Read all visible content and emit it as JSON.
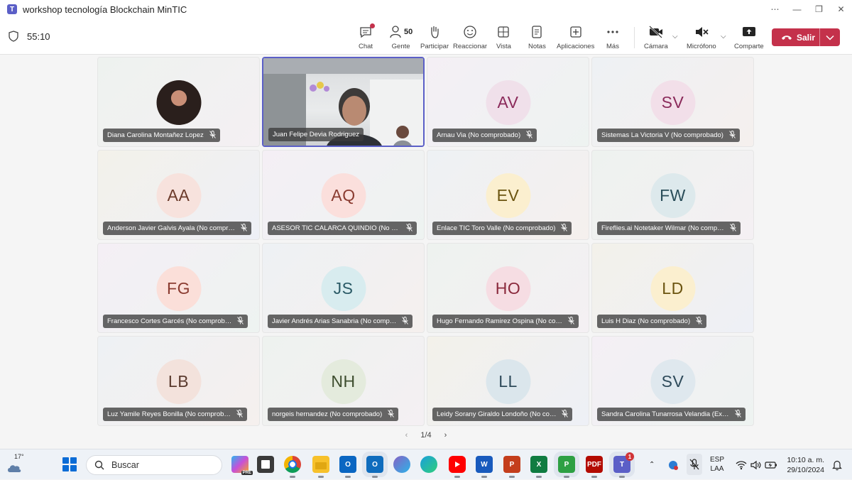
{
  "window": {
    "title": "workshop tecnología Blockchain MinTIC",
    "controls": [
      "⋯",
      "—",
      "❐",
      "✕"
    ]
  },
  "meeting": {
    "timer": "55:10",
    "tools": {
      "chat": "Chat",
      "people": "Gente",
      "people_count": "50",
      "raise": "Participar",
      "react": "Reaccionar",
      "view": "Vista",
      "notes": "Notas",
      "apps": "Aplicaciones",
      "more": "Más",
      "camera": "Cámara",
      "mic": "Micrófono",
      "share": "Comparte"
    },
    "leave": "Salir"
  },
  "participants": [
    {
      "name": "Diana Carolina Montañez Lopez",
      "initials": "",
      "photo": true
    },
    {
      "name": "Juan Felipe Devia Rodriguez",
      "initials": "",
      "video": true
    },
    {
      "name": "Arnau Via (No comprobado)",
      "initials": "AV",
      "bg": "#f0e0ea",
      "fg": "#8a2a5a"
    },
    {
      "name": "Sistemas La Victoria V (No comprobado)",
      "initials": "SV",
      "bg": "#f2dfe9",
      "fg": "#8a2a5a"
    },
    {
      "name": "Anderson Javier Galvis Ayala (No compr…",
      "initials": "AA",
      "bg": "#f7e2dd",
      "fg": "#6b3a2a"
    },
    {
      "name": "ASESOR TIC CALARCA QUINDIO (No c…",
      "initials": "AQ",
      "bg": "#fbdfdc",
      "fg": "#8a3b30"
    },
    {
      "name": "Enlace TIC Toro Valle (No comprobado)",
      "initials": "EV",
      "bg": "#fbefcf",
      "fg": "#6b5410"
    },
    {
      "name": "Fireflies.ai Notetaker Wilmar (No comp…",
      "initials": "FW",
      "bg": "#dde9ec",
      "fg": "#2a4d59"
    },
    {
      "name": "Francesco Cortes Garcés (No comprob…",
      "initials": "FG",
      "bg": "#fbdfd9",
      "fg": "#8a3b30"
    },
    {
      "name": "Javier Andrés Arias Sanabria (No comp…",
      "initials": "JS",
      "bg": "#d8ecef",
      "fg": "#2a5a66"
    },
    {
      "name": "Hugo Fernando Ramirez Ospina (No co…",
      "initials": "HO",
      "bg": "#f6dde3",
      "fg": "#8a2a3d"
    },
    {
      "name": "Luis H Diaz (No comprobado)",
      "initials": "LD",
      "bg": "#fbefcf",
      "fg": "#6b5410"
    },
    {
      "name": "Luz Yamile Reyes Bonilla (No comprob…",
      "initials": "LB",
      "bg": "#f3e2dc",
      "fg": "#5a3a2e"
    },
    {
      "name": "norgeis hernandez (No comprobado)",
      "initials": "NH",
      "bg": "#e4ebdd",
      "fg": "#3d4d2e"
    },
    {
      "name": "Leidy Sorany Giraldo Londoño (No co…",
      "initials": "LL",
      "bg": "#dbe6ec",
      "fg": "#2e4a5a"
    },
    {
      "name": "Sandra Carolina Tunarrosa Velandia (Ex…",
      "initials": "SV",
      "bg": "#dfe8ee",
      "fg": "#2e4a5a"
    }
  ],
  "pager": {
    "label": "1/4"
  },
  "taskbar": {
    "temperature": "17°",
    "search_placeholder": "Buscar",
    "lang_line1": "ESP",
    "lang_line2": "LAA",
    "time": "10:10 a. m.",
    "date": "29/10/2024",
    "teams_badge": "1",
    "copilot_badge": "PRE"
  }
}
